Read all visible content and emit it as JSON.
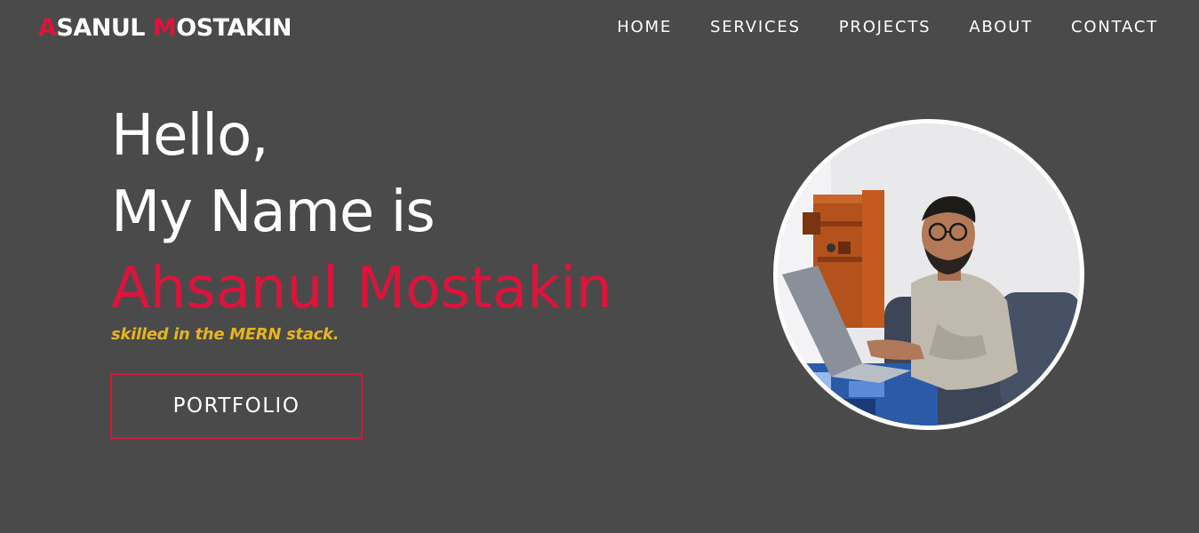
{
  "header": {
    "logo": {
      "part1_accent": "A",
      "part1_rest": "SANUL ",
      "part2_accent": "M",
      "part2_rest": "OSTAKIN"
    },
    "nav": [
      "HOME",
      "SERVICES",
      "PROJECTS",
      "ABOUT",
      "CONTACT"
    ]
  },
  "hero": {
    "greeting": "Hello,",
    "intro": "My Name is",
    "name": "Ahsanul Mostakin",
    "tagline": "skilled in the MERN stack.",
    "button_label": "PORTFOLIO"
  },
  "colors": {
    "background": "#4a4a4a",
    "accent": "#dc143c",
    "tagline": "#e6b422",
    "text": "#ffffff"
  },
  "icons": {
    "profile_photo": "profile-photo"
  }
}
